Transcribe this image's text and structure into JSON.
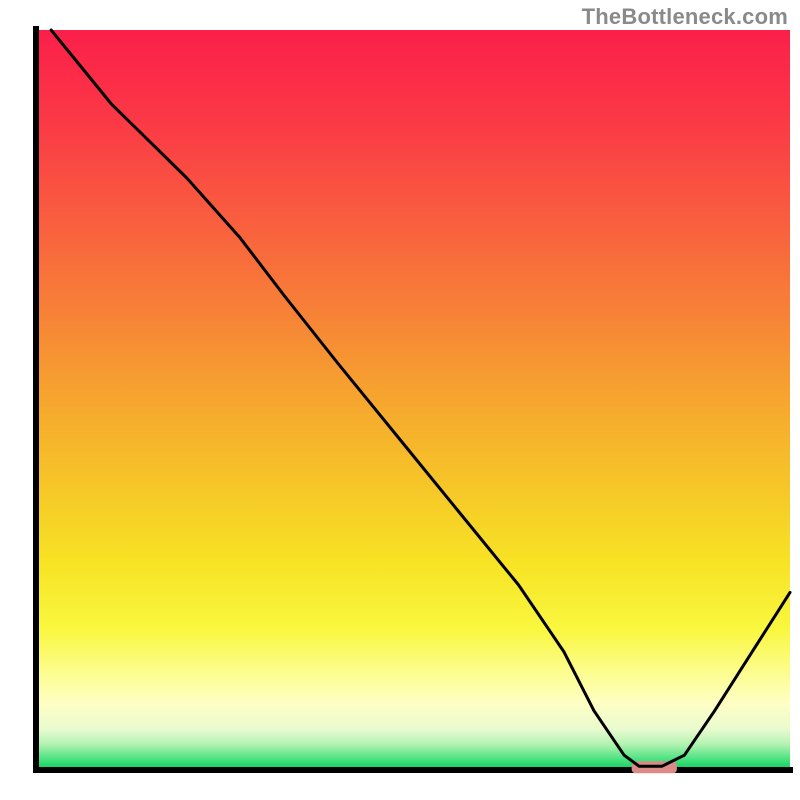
{
  "watermark": "TheBottleneck.com",
  "chart_data": {
    "type": "line",
    "title": "",
    "xlabel": "",
    "ylabel": "",
    "xlim": [
      0,
      100
    ],
    "ylim": [
      0,
      100
    ],
    "x": [
      2,
      10,
      20,
      27,
      33,
      40,
      48,
      56,
      64,
      70,
      74,
      78,
      80,
      83,
      86,
      90,
      95,
      100
    ],
    "y": [
      100,
      90,
      80,
      72,
      64,
      55,
      45,
      35,
      25,
      16,
      8,
      2,
      0.5,
      0.5,
      2,
      8,
      16,
      24
    ],
    "marker": {
      "x_range": [
        79,
        85
      ],
      "y": 0.5,
      "color": "#da8b86"
    },
    "gradient_stops": [
      {
        "offset": 0.0,
        "color": "#fb1f4a"
      },
      {
        "offset": 0.12,
        "color": "#fb3846"
      },
      {
        "offset": 0.25,
        "color": "#f95c3f"
      },
      {
        "offset": 0.38,
        "color": "#f78137"
      },
      {
        "offset": 0.5,
        "color": "#f6a62e"
      },
      {
        "offset": 0.62,
        "color": "#f6c728"
      },
      {
        "offset": 0.72,
        "color": "#f7e324"
      },
      {
        "offset": 0.81,
        "color": "#f9f73f"
      },
      {
        "offset": 0.87,
        "color": "#fcfd91"
      },
      {
        "offset": 0.91,
        "color": "#fefec4"
      },
      {
        "offset": 0.945,
        "color": "#e9fbcf"
      },
      {
        "offset": 0.965,
        "color": "#b3f3b2"
      },
      {
        "offset": 0.985,
        "color": "#4de281"
      },
      {
        "offset": 1.0,
        "color": "#06d05a"
      }
    ],
    "axis_color": "#000000",
    "axis_width": 6,
    "line_color": "#000000",
    "line_width": 3
  }
}
